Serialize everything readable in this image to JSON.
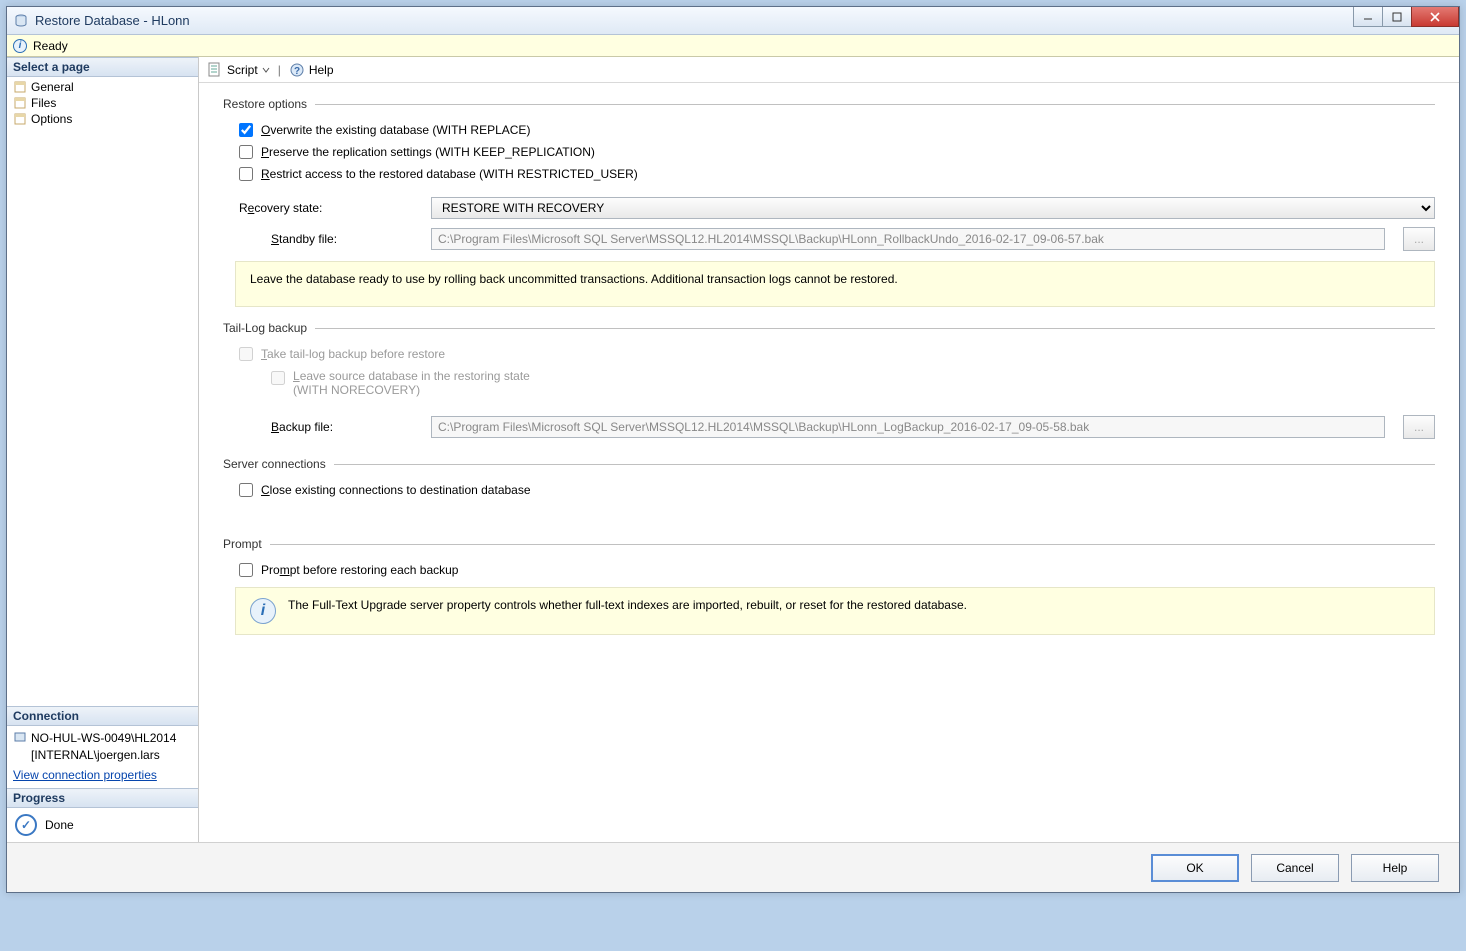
{
  "window": {
    "title": "Restore Database - HLonn"
  },
  "readybar": {
    "text": "Ready"
  },
  "sidebar": {
    "header": "Select a page",
    "pages": [
      {
        "label": "General"
      },
      {
        "label": "Files"
      },
      {
        "label": "Options"
      }
    ]
  },
  "connection": {
    "header": "Connection",
    "server": "NO-HUL-WS-0049\\HL2014",
    "login": "[INTERNAL\\joergen.lars",
    "properties_link": "View connection properties"
  },
  "progress": {
    "header": "Progress",
    "status": "Done"
  },
  "toolbar": {
    "script": "Script",
    "help": "Help"
  },
  "sections": {
    "restore_options": {
      "title": "Restore options",
      "overwrite_label": "Overwrite the existing database (WITH REPLACE)",
      "overwrite_checked": true,
      "preserve_label": "Preserve the replication settings (WITH KEEP_REPLICATION)",
      "preserve_checked": false,
      "restrict_label": "Restrict access to the restored database (WITH RESTRICTED_USER)",
      "restrict_checked": false,
      "recovery_state_label": "Recovery state:",
      "recovery_state_value": "RESTORE WITH RECOVERY",
      "standby_label": "Standby file:",
      "standby_value": "C:\\Program Files\\Microsoft SQL Server\\MSSQL12.HL2014\\MSSQL\\Backup\\HLonn_RollbackUndo_2016-02-17_09-06-57.bak",
      "info": "Leave the database ready to use by rolling back uncommitted transactions. Additional transaction logs cannot be restored."
    },
    "tail_log": {
      "title": "Tail-Log backup",
      "take_label": "Take tail-log backup before restore",
      "leave_label_line1": "Leave source database in the restoring state",
      "leave_label_line2": "(WITH NORECOVERY)",
      "backup_file_label": "Backup file:",
      "backup_file_value": "C:\\Program Files\\Microsoft SQL Server\\MSSQL12.HL2014\\MSSQL\\Backup\\HLonn_LogBackup_2016-02-17_09-05-58.bak"
    },
    "server_conn": {
      "title": "Server connections",
      "close_label": "Close existing connections to destination database"
    },
    "prompt": {
      "title": "Prompt",
      "prompt_label": "Prompt before restoring each backup",
      "fulltext_info": "The Full-Text Upgrade server property controls whether full-text indexes are imported, rebuilt, or reset for the restored database."
    }
  },
  "buttons": {
    "ok": "OK",
    "cancel": "Cancel",
    "help": "Help"
  }
}
